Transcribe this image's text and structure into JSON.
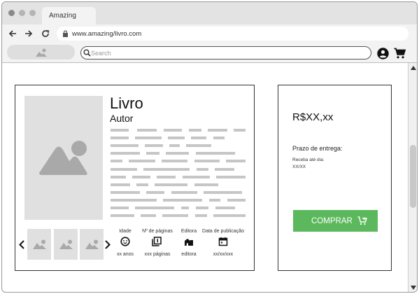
{
  "browser": {
    "tab_title": "Amazing",
    "url": "www.amazing/livro.com"
  },
  "toolbar": {
    "search_placeholder": "Search"
  },
  "product": {
    "title": "Livro",
    "author": "Autor",
    "meta": [
      {
        "label": "Idade",
        "value": "xx anos",
        "icon": "face-icon"
      },
      {
        "label": "Nº de páginas",
        "value": "xxx páginas",
        "icon": "pages-icon"
      },
      {
        "label": "Editora",
        "value": "editora",
        "icon": "publisher-icon"
      },
      {
        "label": "Data de publicação",
        "value": "xx/xx/xxx",
        "icon": "calendar-icon"
      }
    ]
  },
  "purchase": {
    "price": "R$XX,xx",
    "delivery_label": "Prazo de entrega:",
    "receive_label": "Receba até dia:",
    "receive_date": "XX/XX",
    "buy_label": "COMPRAR"
  },
  "colors": {
    "buy_button": "#5cb85c",
    "placeholder_gray": "#e0e0e0",
    "text_line_gray": "#c6c6c6"
  }
}
